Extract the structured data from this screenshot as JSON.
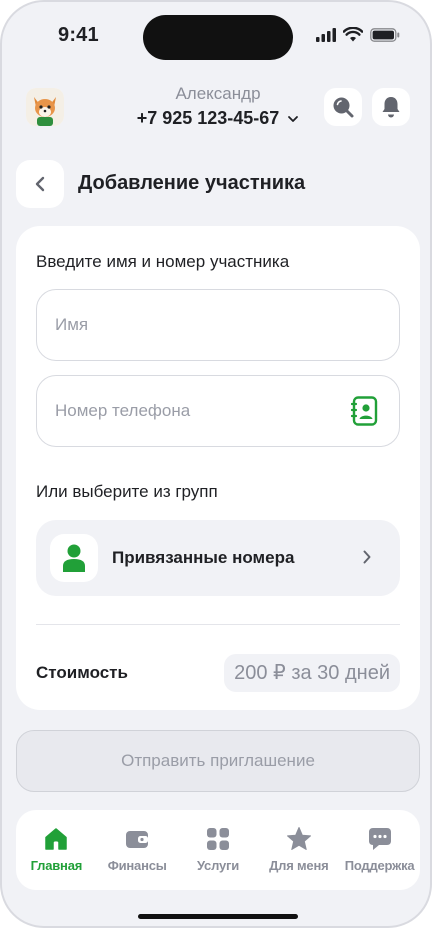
{
  "status_bar": {
    "time": "9:41"
  },
  "profile": {
    "name": "Александр",
    "phone": "+7 925 123-45-67"
  },
  "header": {
    "title": "Добавление участника"
  },
  "form": {
    "instruction": "Введите имя и номер участника",
    "name_placeholder": "Имя",
    "name_value": "",
    "phone_placeholder": "Номер телефона",
    "phone_value": "",
    "groups_label": "Или выберите из групп",
    "group_item": "Привязанные номера",
    "cost_label": "Стоимость",
    "cost_value": "200 ₽ за 30 дней"
  },
  "send_button": "Отправить приглашение",
  "tabs": [
    {
      "label": "Главная",
      "icon": "home-icon",
      "active": true
    },
    {
      "label": "Финансы",
      "icon": "wallet-icon",
      "active": false
    },
    {
      "label": "Услуги",
      "icon": "services-grid-icon",
      "active": false
    },
    {
      "label": "Для меня",
      "icon": "star-icon",
      "active": false
    },
    {
      "label": "Поддержка",
      "icon": "chat-icon",
      "active": false
    }
  ],
  "colors": {
    "accent": "#21a038",
    "inactive": "#8b8e99",
    "background": "#f1f2f6"
  }
}
